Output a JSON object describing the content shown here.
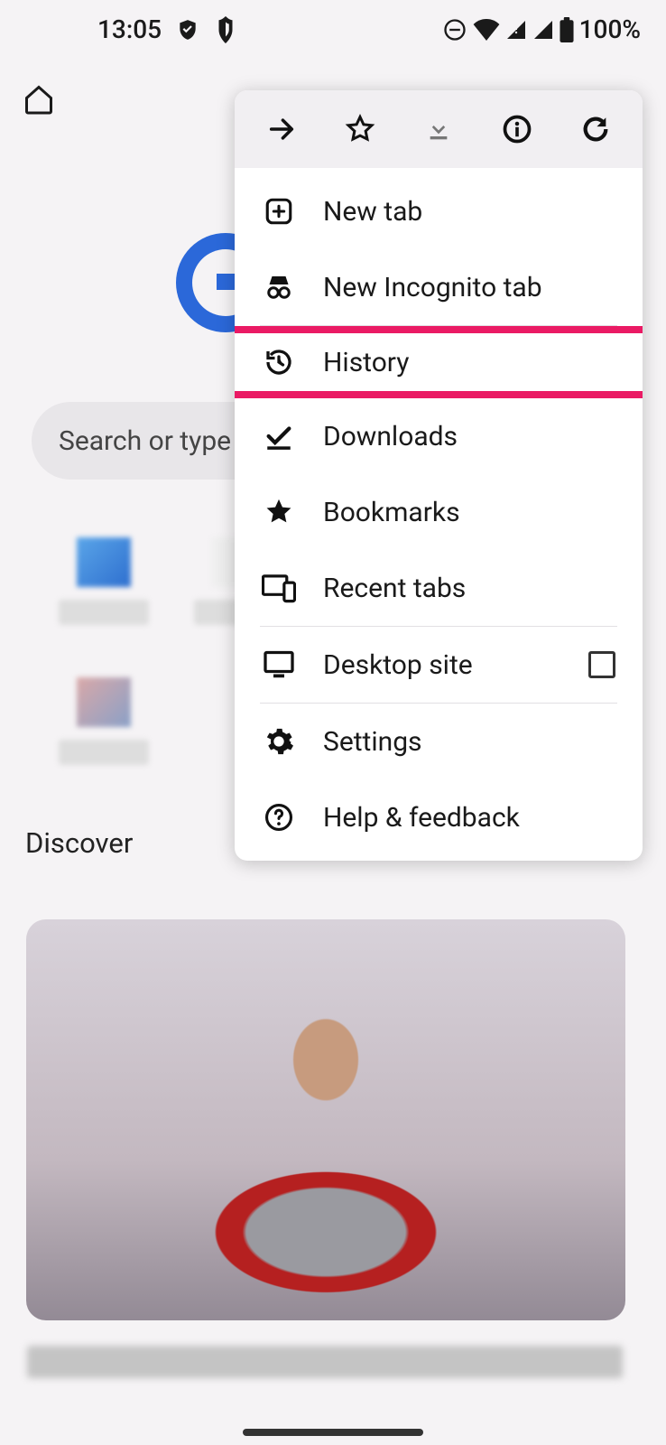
{
  "status": {
    "time": "13:05",
    "battery": "100%"
  },
  "search": {
    "placeholder": "Search or type w"
  },
  "discover_label": "Discover",
  "menu": {
    "new_tab": "New tab",
    "incognito": "New Incognito tab",
    "history": "History",
    "downloads": "Downloads",
    "bookmarks": "Bookmarks",
    "recent_tabs": "Recent tabs",
    "desktop_site": "Desktop site",
    "settings": "Settings",
    "help": "Help & feedback"
  }
}
